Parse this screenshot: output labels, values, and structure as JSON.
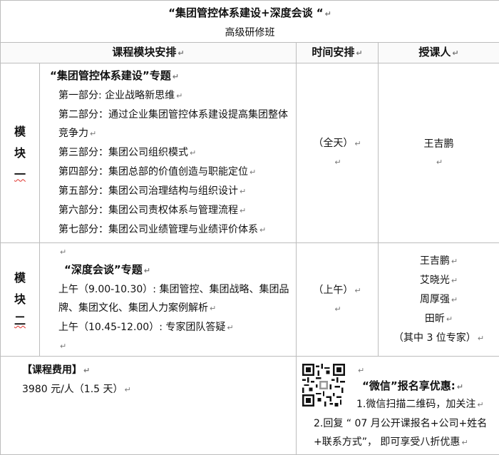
{
  "header": {
    "title": "“集团管控体系建设+深度会谈 “",
    "subtitle": "高级研修班"
  },
  "columns": {
    "course": "课程模块安排",
    "time": "时间安排",
    "teacher": "授课人"
  },
  "module1": {
    "label_chars": [
      "模",
      "块",
      "一"
    ],
    "topic": "“集团管控体系建设”专题",
    "items": [
      "第一部分: 企业战略新思维",
      "第二部分：通过企业集团管控体系建设提高集团整体竞争力",
      "第三部分：集团公司组织模式",
      "第四部分：集团总部的价值创造与职能定位",
      "第五部分：集团公司治理结构与组织设计",
      "第六部分：集团公司责权体系与管理流程",
      "第七部分：集团公司业绩管理与业绩评价体系"
    ],
    "time": "（全天）",
    "teacher": "王吉鹏"
  },
  "module2": {
    "label_chars": [
      "模",
      "块",
      "二"
    ],
    "topic": "“深度会谈”专题",
    "morning1": "上午（9.00-10.30）: 集团管控、集团战略、集团品牌、集团文化、集团人力案例解析",
    "morning2": "上午（10.45-12.00）: 专家团队答疑",
    "time": "（上午）",
    "teachers": [
      "王吉鹏",
      "艾晓光",
      "周厚强",
      "田昕"
    ],
    "teachers_note": "（其中 3 位专家）"
  },
  "fee": {
    "label": "【课程费用】",
    "price": "3980 元/人（1.5 天）"
  },
  "wechat": {
    "title": "“微信”报名享优惠:",
    "step1": "1.微信扫描二维码，加关注",
    "step2": "2.回复 “ 07 月公开课报名+公司+姓名+联系方式”， 即可享受八折优惠"
  },
  "marks": {
    "para": "↵"
  }
}
